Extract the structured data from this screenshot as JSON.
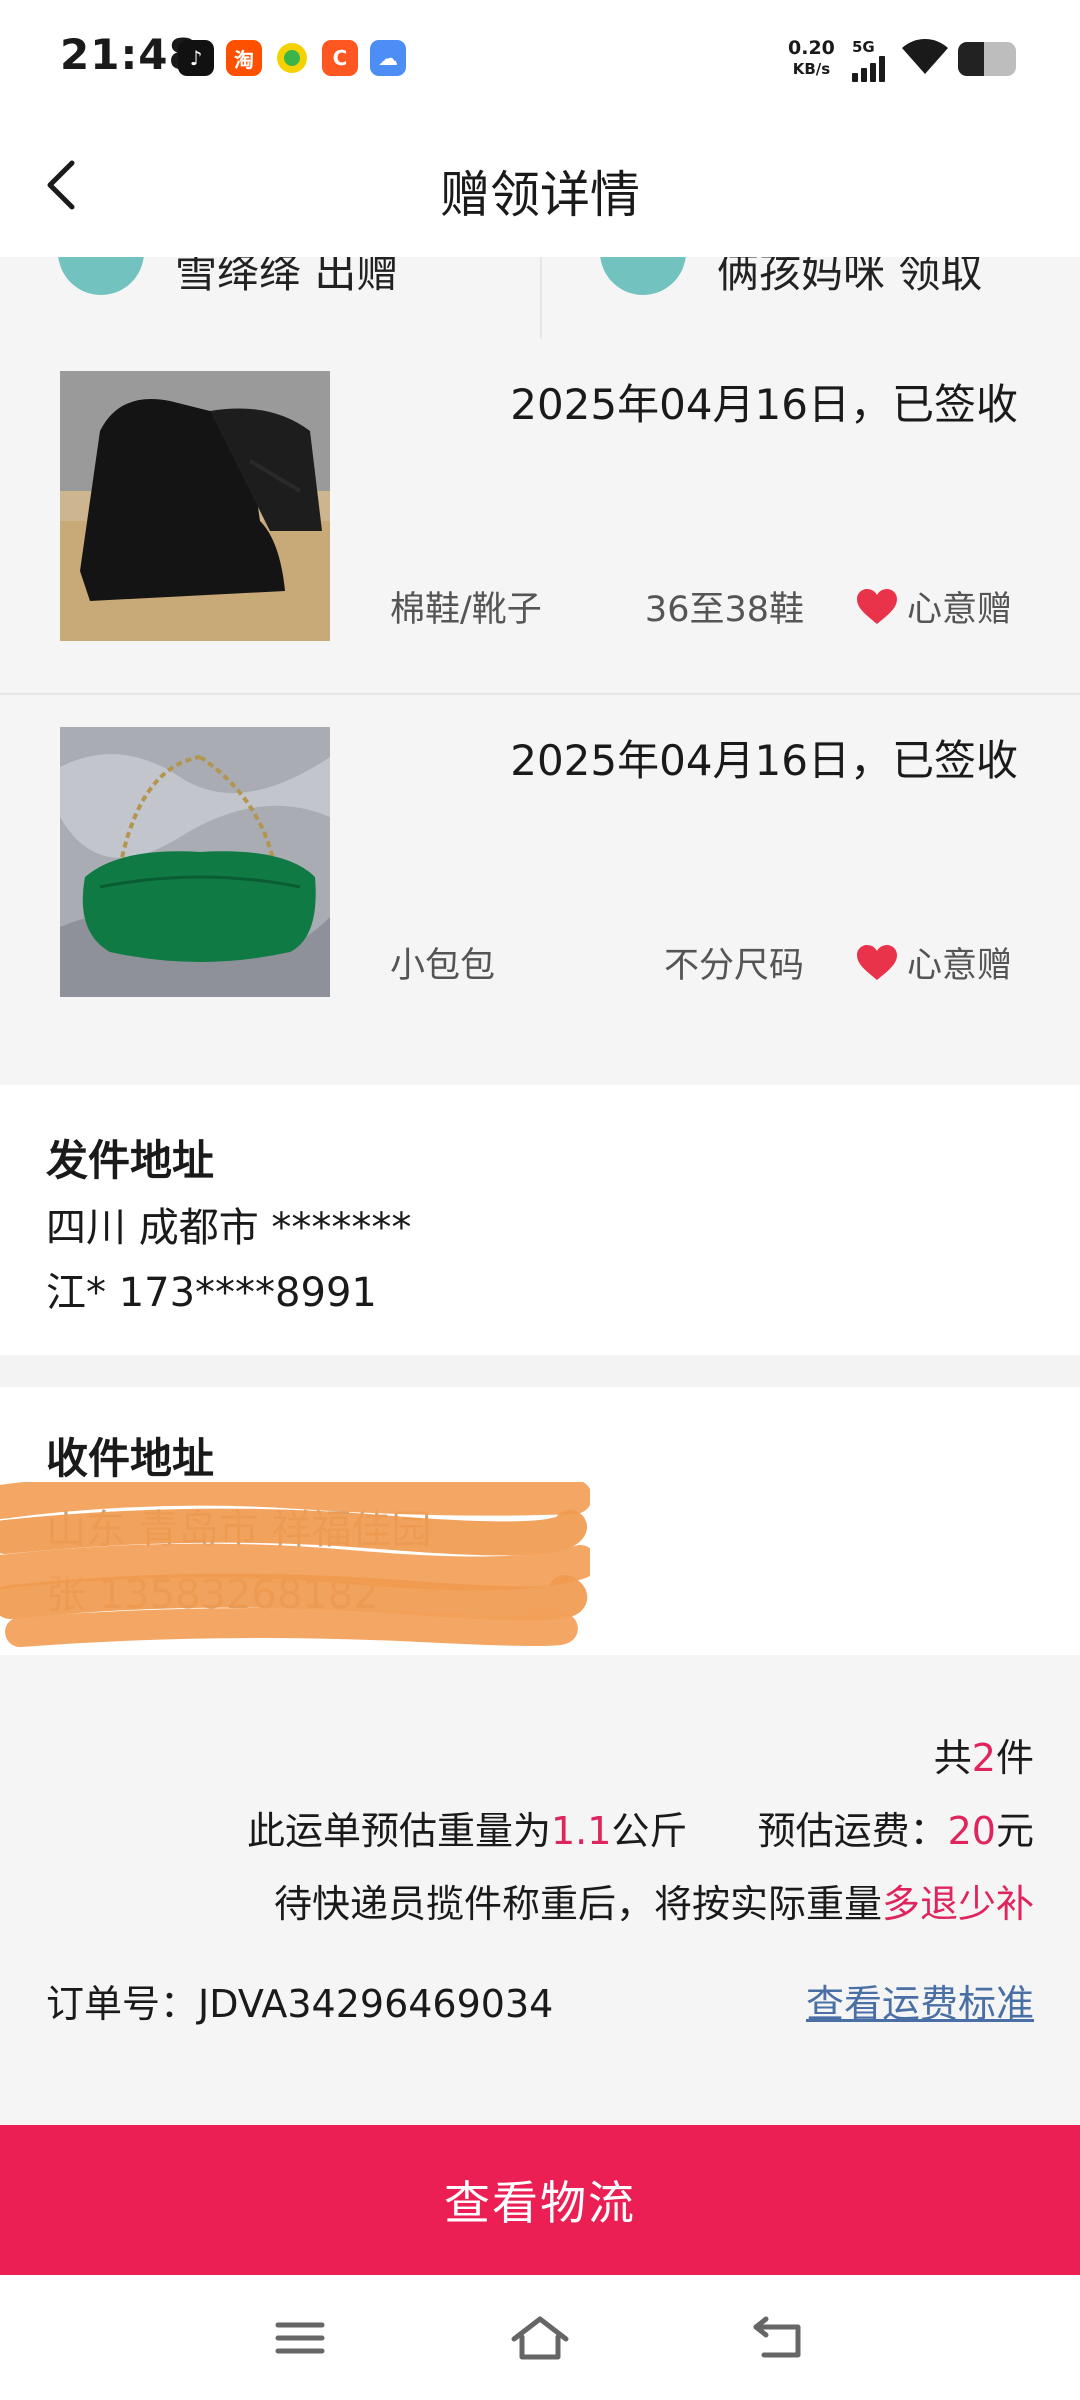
{
  "status_bar": {
    "time": "21:48",
    "app_icons": [
      {
        "name": "tiktok-icon",
        "glyph": "♪",
        "color": "#111111"
      },
      {
        "name": "taobao-icon",
        "glyph": "淘",
        "color": "#ff5000"
      },
      {
        "name": "game-icon",
        "glyph": "●",
        "color": "#f5d100"
      },
      {
        "name": "coupon-icon",
        "glyph": "C",
        "color": "#ff5722"
      },
      {
        "name": "weather-icon",
        "glyph": "☁",
        "color": "#4c8df6"
      }
    ],
    "net_speed": "0.20",
    "net_unit": "KB/s",
    "network": "5G",
    "battery_level": 0.45
  },
  "header": {
    "title": "赠领详情"
  },
  "donor_row": {
    "left_text": "雪绛绛 出赠",
    "right_text": "俩孩妈咪 领取"
  },
  "items": [
    {
      "date_status": "2025年04月16日，已签收",
      "category": "棉鞋/靴子",
      "size": "36至38鞋",
      "tag": "心意赠",
      "image": "black-suede-boot"
    },
    {
      "date_status": "2025年04月16日，已签收",
      "category": "小包包",
      "size": "不分尺码",
      "tag": "心意赠",
      "image": "green-leather-bag"
    }
  ],
  "sender": {
    "title": "发件地址",
    "line1": "四川 成都市 *******",
    "line2": "江* 173****8991"
  },
  "receiver": {
    "title": "收件地址",
    "line1": "山东 青岛市 祥福佳园",
    "line2": "张 13583268182"
  },
  "summary": {
    "count_prefix": "共",
    "count": "2",
    "count_suffix": "件",
    "weight_prefix": "此运单预估重量为",
    "weight": "1.1",
    "weight_unit": "公斤",
    "fee_prefix": "预估运费：",
    "fee": "20",
    "fee_unit": "元",
    "note_prefix": "待快递员揽件称重后，将按实际重量",
    "note_highlight": "多退少补",
    "order_label": "订单号：",
    "order_no": "JDVA34296469034",
    "fee_link": "查看运费标准"
  },
  "actions": {
    "track_label": "查看物流"
  }
}
